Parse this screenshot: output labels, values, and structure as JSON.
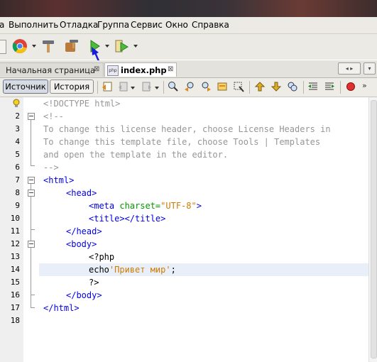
{
  "menu": [
    "а",
    "Выполнить",
    "Отладка",
    "Группа",
    "Сервис",
    "Окно",
    "Справка"
  ],
  "tabs": [
    {
      "label": "Начальная страница",
      "close": "⊠"
    },
    {
      "label": "index.php",
      "close": "⊠"
    }
  ],
  "tab_nav": "◂ ▸",
  "tab_dropdown": "▾",
  "php_icon_text": "php",
  "editor_tabs": [
    "Источник",
    "История"
  ],
  "line_numbers": [
    "1",
    "2",
    "3",
    "4",
    "5",
    "6",
    "7",
    "8",
    "9",
    "10",
    "11",
    "12",
    "13",
    "14",
    "15",
    "16",
    "17",
    "18"
  ],
  "code": {
    "l1": "<!DOCTYPE html>",
    "l2": "<!--",
    "l3": "To change this license header, choose License Headers in",
    "l4": "To change this template file, choose Tools | Templates",
    "l5": "and open the template in the editor.",
    "l6": "-->",
    "l7": "<html>",
    "l8": "<head>",
    "l9a": "<meta ",
    "l9b": "charset=",
    "l9c": "\"UTF-8\"",
    "l9d": ">",
    "l10": "<title></title>",
    "l11": "</head>",
    "l12": "<body>",
    "l13": "<?php",
    "l14a": "echo",
    "l14b": "'Привет мир'",
    "l14c": ";",
    "l15": "?>",
    "l16": "</body>",
    "l17": "</html>"
  },
  "colors": {
    "tag": "#0000e6",
    "comment": "#969696",
    "attr": "#009900",
    "string": "#ce7b00",
    "current_line": "#e9eff8"
  }
}
